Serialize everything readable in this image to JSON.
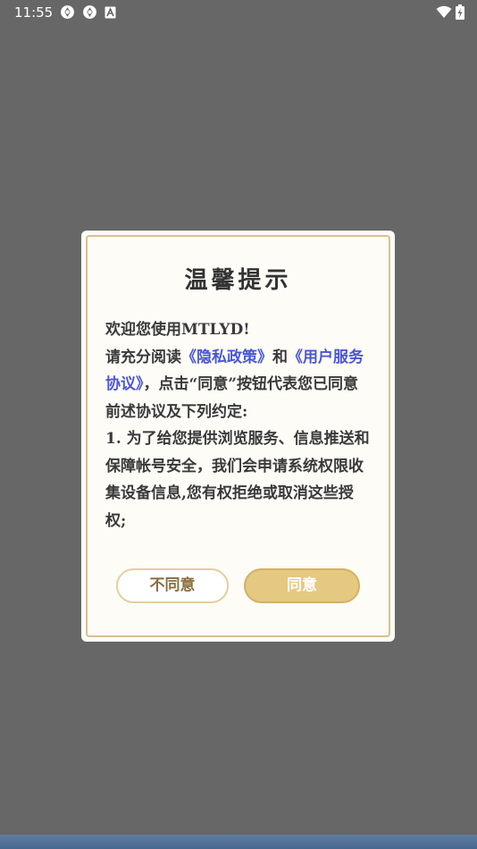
{
  "status_bar": {
    "time": "11:55",
    "left_icons": [
      "sync-icon",
      "sync-icon",
      "font-a-icon"
    ],
    "right_icons": [
      "wifi-icon",
      "battery-charging-icon"
    ]
  },
  "dialog": {
    "title": "温馨提示",
    "body": {
      "line_welcome": "欢迎您使用MTLYD!",
      "read_prefix": "请充分阅读",
      "privacy_link": "《隐私政策》",
      "and_text": "和",
      "service_link": "《用户服务协议》",
      "read_suffix": "，点击“同意”按钮代表您已同意前述协议及下列约定:",
      "item_1": "1. 为了给您提供浏览服务、信息推送和保障帐号安全，我们会申请系统权限收集设备信息,您有权拒绝或取消这些授权;"
    },
    "buttons": {
      "disagree_label": "不同意",
      "agree_label": "同意"
    }
  },
  "colors": {
    "backdrop": "#676767",
    "dialog_bg": "#fdfcf7",
    "gold_border": "#d9c18c",
    "agree_fill": "#e6c980",
    "link": "#4a56d6"
  }
}
